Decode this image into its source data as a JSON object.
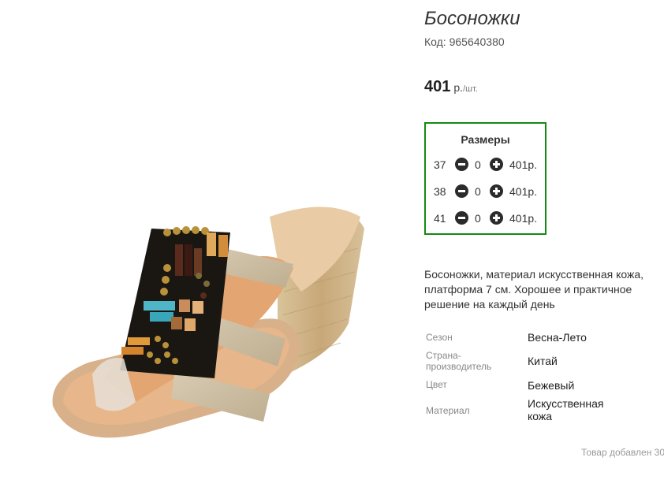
{
  "product": {
    "title": "Босоножки",
    "code": "Код: 965640380",
    "price": "401",
    "price_unit_main": "р.",
    "price_unit_sub": "/шт.",
    "image_alt": "Босоножки"
  },
  "sizes": {
    "title": "Размеры",
    "rows": [
      {
        "size": "37",
        "qty": "0",
        "price": "401р."
      },
      {
        "size": "38",
        "qty": "0",
        "price": "401р."
      },
      {
        "size": "41",
        "qty": "0",
        "price": "401р."
      }
    ],
    "border_color": "#138a13"
  },
  "description": "Босоножки, материал искусственная кожа, платформа 7 см. Хорошее и практичное решение на каждый день",
  "specs": [
    {
      "label": "Сезон",
      "value": "Весна-Лето"
    },
    {
      "label": "Страна-производитель",
      "label_line1": "Страна-",
      "label_line2": "производитель",
      "value": "Китай"
    },
    {
      "label": "Цвет",
      "value": "Бежевый"
    },
    {
      "label": "Материал",
      "value_line1": "Искусственная",
      "value_line2": "кожа"
    }
  ],
  "added_text": "Товар добавлен 30",
  "icons": {
    "minus": "minus-circle-icon",
    "plus": "plus-circle-icon"
  }
}
